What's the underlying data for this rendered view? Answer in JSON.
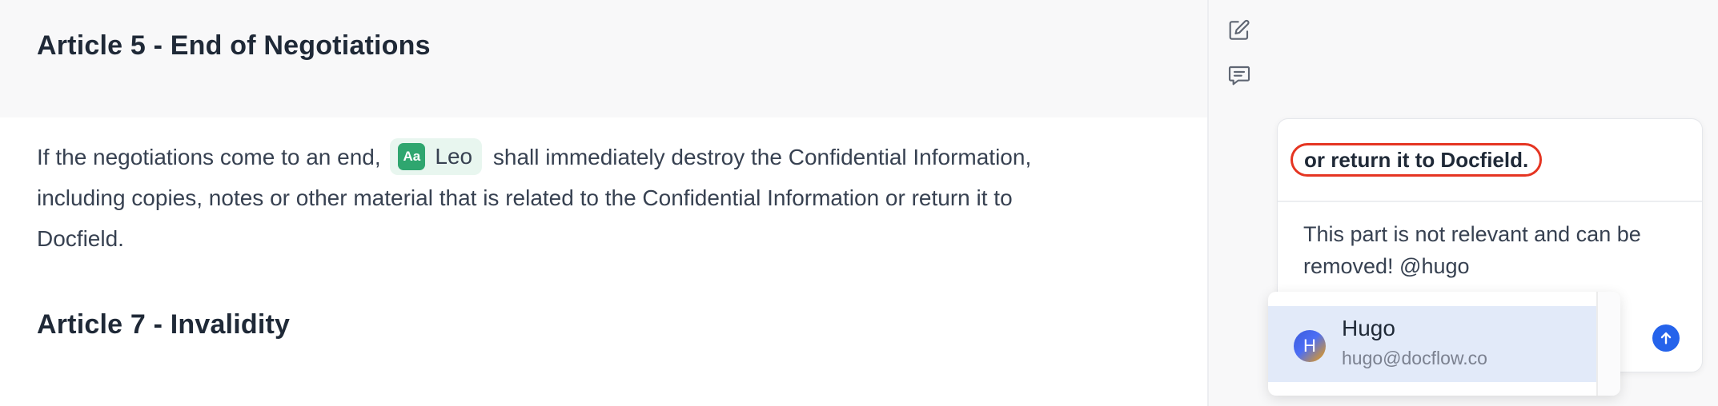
{
  "document": {
    "article5_title": "Article 5 - End of Negotiations",
    "paragraph": {
      "before_chip": "If the negotiations come to an end,",
      "chip_badge": "Aa",
      "chip_name": "Leo",
      "after_chip": "shall immediately destroy the Confidential Information, including copies, notes or other material that is related to the Confidential Information or return it to Docfield."
    },
    "article7_title": "Article 7 - Invalidity"
  },
  "sidebar": {
    "edit_icon": "edit-icon",
    "comment_icon": "comment-icon"
  },
  "comment_card": {
    "quoted_text": "or return it to Docfield.",
    "comment_text": "This part is not relevant and can be removed! @hugo",
    "send_icon": "arrow-up-icon"
  },
  "mention_dropdown": {
    "items": [
      {
        "initial": "H",
        "name": "Hugo",
        "email": "hugo@docflow.co"
      }
    ]
  },
  "colors": {
    "chip_bg": "#e8f6ef",
    "chip_badge": "#2fa66f",
    "quote_outline": "#e53522",
    "send_button": "#2563eb",
    "mention_highlight": "#e2eaf9"
  }
}
